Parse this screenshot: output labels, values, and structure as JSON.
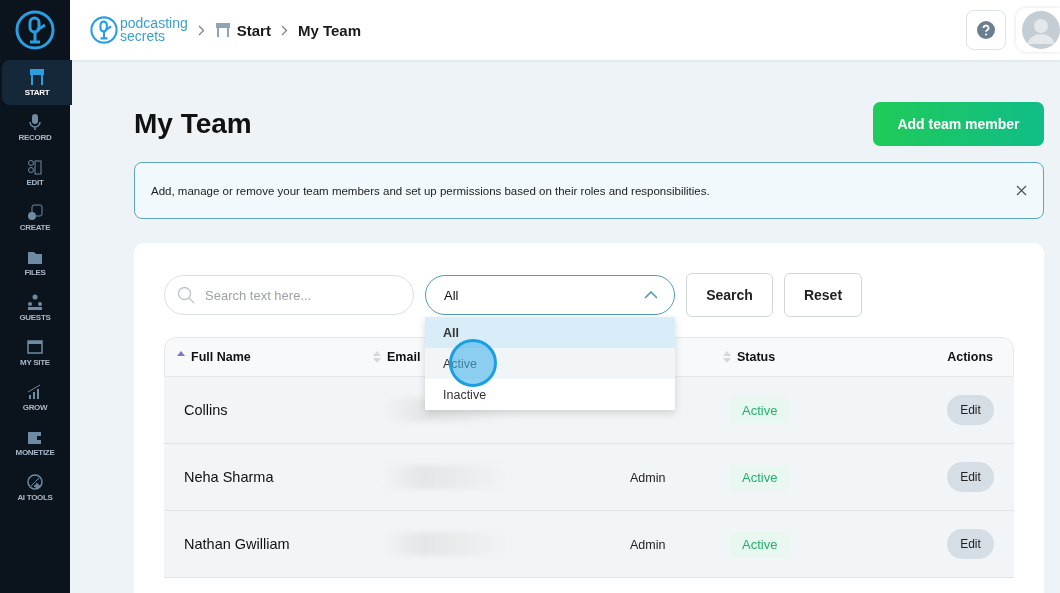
{
  "sidebar": {
    "items": [
      {
        "label": "START",
        "kind": "start",
        "selected": true
      },
      {
        "label": "RECORD",
        "kind": "mic",
        "selected": false
      },
      {
        "label": "EDIT",
        "kind": "edit",
        "selected": false
      },
      {
        "label": "CREATE",
        "kind": "create",
        "selected": false
      },
      {
        "label": "FILES",
        "kind": "files",
        "selected": false
      },
      {
        "label": "GUESTS",
        "kind": "guests",
        "selected": false
      },
      {
        "label": "MY SITE",
        "kind": "site",
        "selected": false
      },
      {
        "label": "GROW",
        "kind": "grow",
        "selected": false
      },
      {
        "label": "MONETIZE",
        "kind": "wallet",
        "selected": false
      },
      {
        "label": "AI TOOLS",
        "kind": "ai",
        "selected": false
      }
    ]
  },
  "header": {
    "logo": [
      "podcasting",
      "secrets"
    ],
    "breadcrumb": [
      "Start",
      "My Team"
    ]
  },
  "page": {
    "title": "My Team",
    "add_button": "Add team member",
    "info": "Add, manage or remove your team members and set up permissions based on their roles and responsibilities."
  },
  "filters": {
    "search": {
      "placeholder": "Search text here..."
    },
    "status_select": {
      "value": "All",
      "expanded": true,
      "options": [
        {
          "label": "All",
          "selected": true,
          "hovered": false
        },
        {
          "label": "Active",
          "selected": false,
          "hovered": true
        },
        {
          "label": "Inactive",
          "selected": false,
          "hovered": false
        }
      ]
    },
    "buttons": [
      "Search",
      "Reset"
    ]
  },
  "table": {
    "columns": [
      {
        "label": "Full Name",
        "kind": "sorted"
      },
      {
        "label": "Email",
        "kind": "sortable"
      },
      {
        "label": "Status",
        "kind": "sortable"
      },
      {
        "label": "Actions",
        "kind": "plain"
      }
    ],
    "rows": [
      {
        "name": "Collins",
        "role": "",
        "status": "Active",
        "action": "Edit"
      },
      {
        "name": "Neha Sharma",
        "role": "Admin",
        "status": "Active",
        "action": "Edit"
      },
      {
        "name": "Nathan Gwilliam",
        "role": "Admin",
        "status": "Active",
        "action": "Edit"
      }
    ]
  }
}
